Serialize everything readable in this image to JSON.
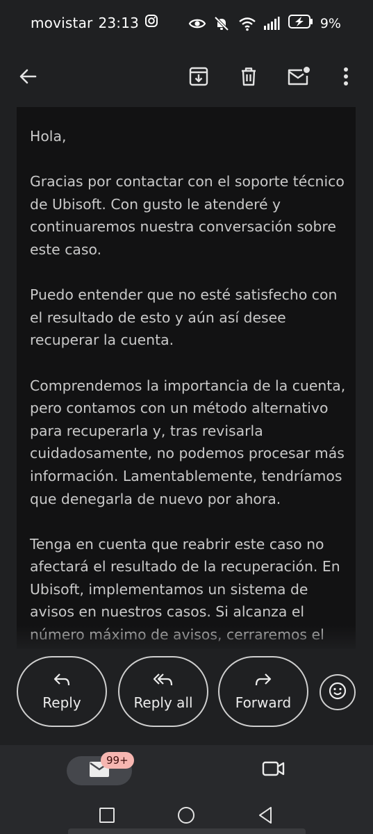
{
  "status_bar": {
    "carrier": "movistar",
    "time": "23:13",
    "battery_percent": "9%",
    "icons": [
      "instagram-icon",
      "eye-icon",
      "bell-off-icon",
      "wifi-icon",
      "signal-icon",
      "battery-charging-icon"
    ]
  },
  "toolbar": {
    "icons": [
      "back-arrow-icon",
      "archive-icon",
      "delete-icon",
      "mark-unread-icon",
      "more-vertical-icon"
    ]
  },
  "email": {
    "paragraphs": [
      "Hola,",
      "Gracias por contactar con el soporte técnico de Ubisoft. Con gusto le atenderé y continuaremos nuestra conversación sobre este caso.",
      "Puedo entender que no esté satisfecho con el resultado de esto y aún así desee recuperar la cuenta.",
      "Comprendemos la importancia de la cuenta, pero contamos con un método alternativo para recuperarla y, tras revisarla cuidadosamente, no podemos procesar más información. Lamentablemente, tendríamos que denegarla de nuevo por ahora.",
      "Tenga en cuenta que reabrir este caso no afectará el resultado de la recuperación. En Ubisoft, implementamos un sistema de avisos en nuestros casos. Si alcanza el número máximo de avisos, cerraremos el"
    ]
  },
  "actions": {
    "reply_label": "Reply",
    "reply_all_label": "Reply all",
    "forward_label": "Forward"
  },
  "bottom_nav": {
    "mail_badge": "99+"
  },
  "colors": {
    "background": "#1f2022",
    "body_panel": "#121213",
    "badge": "#f6b6b1"
  }
}
